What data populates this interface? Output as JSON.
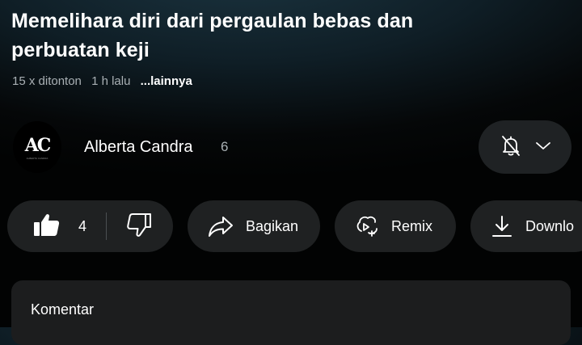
{
  "video": {
    "title": "Memelihara diri dari pergaulan bebas dan perbuatan keji",
    "views": "15 x ditonton",
    "age": "1 h lalu",
    "more": "...lainnya"
  },
  "channel": {
    "avatar_text": "AC",
    "avatar_subtext": "ALBERTA CANDRA",
    "name": "Alberta Candra",
    "subscribers": "6",
    "bell_icon": "bell-off-icon",
    "dropdown_icon": "chevron-down-icon"
  },
  "actions": {
    "like_count": "4",
    "share_label": "Bagikan",
    "remix_label": "Remix",
    "download_label": "Downlo"
  },
  "comments": {
    "header": "Komentar"
  }
}
